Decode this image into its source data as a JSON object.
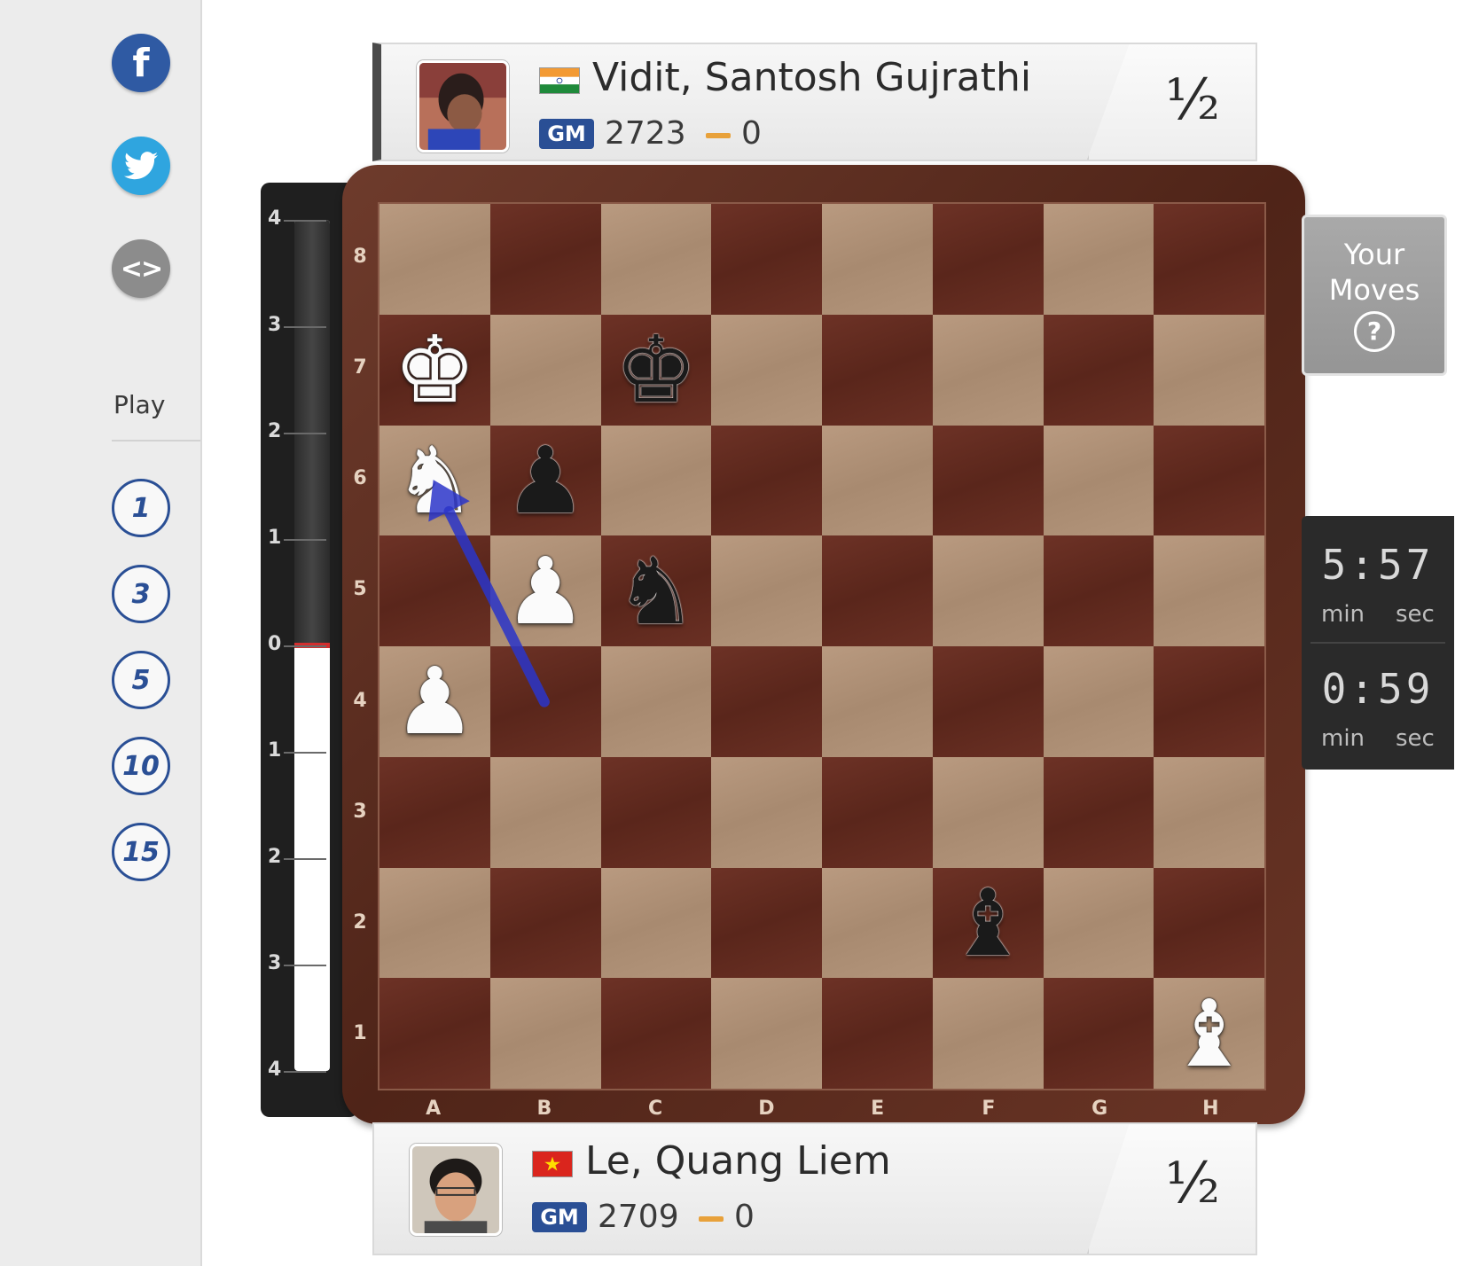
{
  "sidebar": {
    "social": [
      {
        "name": "facebook",
        "glyph": "f",
        "color": "#2f5aa3"
      },
      {
        "name": "twitter",
        "glyph": "bird",
        "color": "#2fa5df"
      },
      {
        "name": "embed",
        "glyph": "<>",
        "color": "#8c8c8c"
      }
    ],
    "play_label": "Play",
    "play_options": [
      "1",
      "3",
      "5",
      "10",
      "15"
    ]
  },
  "players": {
    "top": {
      "name": "Vidit, Santosh Gujrathi",
      "title": "GM",
      "rating": "2723",
      "score": "0",
      "result": "½",
      "flag": "india"
    },
    "bottom": {
      "name": "Le, Quang Liem",
      "title": "GM",
      "rating": "2709",
      "score": "0",
      "result": "½",
      "flag": "vietnam"
    }
  },
  "eval_bar": {
    "ticks": [
      "4",
      "3",
      "2",
      "1",
      "0",
      "1",
      "2",
      "3",
      "4"
    ],
    "value": 0.0
  },
  "board": {
    "ranks": [
      "8",
      "7",
      "6",
      "5",
      "4",
      "3",
      "2",
      "1"
    ],
    "files": [
      "A",
      "B",
      "C",
      "D",
      "E",
      "F",
      "G",
      "H"
    ],
    "pieces": [
      {
        "square": "a7",
        "piece": "K",
        "color": "white"
      },
      {
        "square": "c7",
        "piece": "K",
        "color": "black"
      },
      {
        "square": "a6",
        "piece": "N",
        "color": "white"
      },
      {
        "square": "b6",
        "piece": "P",
        "color": "black"
      },
      {
        "square": "b5",
        "piece": "P",
        "color": "white"
      },
      {
        "square": "c5",
        "piece": "N",
        "color": "black"
      },
      {
        "square": "a4",
        "piece": "P",
        "color": "white"
      },
      {
        "square": "f2",
        "piece": "B",
        "color": "black"
      },
      {
        "square": "h1",
        "piece": "B",
        "color": "white"
      }
    ],
    "last_move_arrow": {
      "from": "b4",
      "to": "a6",
      "color": "#2b35c9"
    }
  },
  "your_moves": {
    "line1": "Your",
    "line2": "Moves",
    "help": "?"
  },
  "clocks": {
    "top": {
      "time": "5:57",
      "min_label": "min",
      "sec_label": "sec"
    },
    "bottom": {
      "time": "0:59",
      "min_label": "min",
      "sec_label": "sec"
    }
  }
}
